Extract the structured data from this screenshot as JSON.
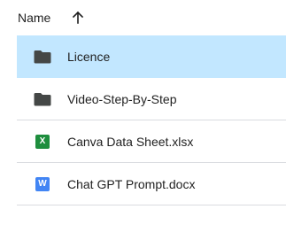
{
  "header": {
    "name_label": "Name",
    "sort_icon": "arrow-up-icon"
  },
  "files": [
    {
      "name": "Licence",
      "icon": "folder-icon",
      "selected": true
    },
    {
      "name": "Video-Step-By-Step",
      "icon": "folder-icon",
      "selected": false
    },
    {
      "name": "Canva Data Sheet.xlsx",
      "icon": "sheets-icon",
      "badge": "X",
      "badge_color": "#1e8e3e",
      "selected": false
    },
    {
      "name": "Chat GPT Prompt.docx",
      "icon": "docs-icon",
      "badge": "W",
      "badge_color": "#4285f4",
      "selected": false
    }
  ],
  "colors": {
    "selected_row": "#c2e7ff",
    "folder": "#444746",
    "divider": "#dadce0"
  }
}
